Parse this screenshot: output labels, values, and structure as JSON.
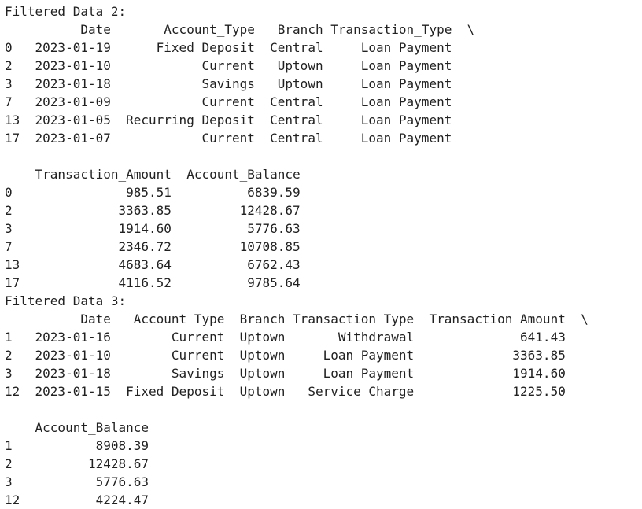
{
  "output": {
    "lines": [
      "Filtered Data 2:",
      "          Date       Account_Type   Branch Transaction_Type  \\",
      "0   2023-01-19      Fixed Deposit  Central     Loan Payment",
      "2   2023-01-10            Current   Uptown     Loan Payment",
      "3   2023-01-18            Savings   Uptown     Loan Payment",
      "7   2023-01-09            Current  Central     Loan Payment",
      "13  2023-01-05  Recurring Deposit  Central     Loan Payment",
      "17  2023-01-07            Current  Central     Loan Payment",
      "",
      "    Transaction_Amount  Account_Balance",
      "0               985.51          6839.59",
      "2              3363.85         12428.67",
      "3              1914.60          5776.63",
      "7              2346.72         10708.85",
      "13             4683.64          6762.43",
      "17             4116.52          9785.64",
      "Filtered Data 3:",
      "          Date   Account_Type  Branch Transaction_Type  Transaction_Amount  \\",
      "1   2023-01-16        Current  Uptown       Withdrawal              641.43",
      "2   2023-01-10        Current  Uptown     Loan Payment             3363.85",
      "3   2023-01-18        Savings  Uptown     Loan Payment             1914.60",
      "12  2023-01-15  Fixed Deposit  Uptown   Service Charge             1225.50",
      "",
      "    Account_Balance",
      "1           8908.39",
      "2          12428.67",
      "3           5776.63",
      "12          4224.47"
    ]
  }
}
